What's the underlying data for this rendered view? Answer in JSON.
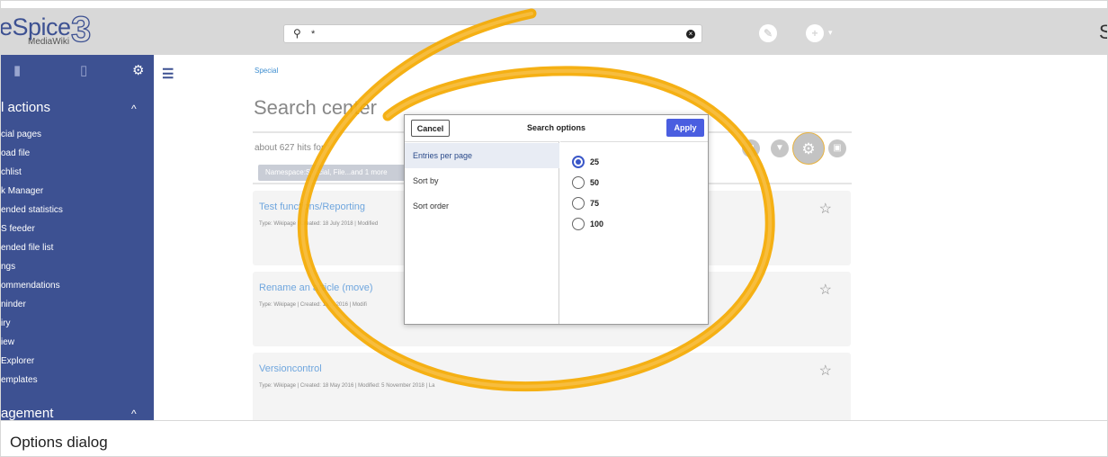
{
  "header": {
    "logo_text": "eSpice",
    "logo_sub": "MediaWiki",
    "logo_number": "3",
    "search_icon": "search-icon",
    "search_value": "*",
    "clear_icon": "clear-icon",
    "edit_icon": "pencil-icon",
    "add_icon": "plus-icon",
    "add_caret": "▾",
    "user_partial": "S"
  },
  "sidebar": {
    "tab_icons": [
      "book-icon",
      "clipboard-icon",
      "gear-icon"
    ],
    "group_title": "l actions",
    "items": [
      "cial pages",
      "oad file",
      "chlist",
      "k Manager",
      "ended statistics",
      "S feeder",
      "ended file list",
      "ngs",
      "ommendations",
      "ninder",
      "iry",
      "iew",
      "Explorer",
      "emplates"
    ],
    "group2_title": "agement",
    "chevron": "^"
  },
  "main": {
    "breadcrumb": "Special",
    "title": "Search center",
    "hits_text": "about 627 hits for *",
    "filter_chip": "Namespace:Special, File...and 1 more",
    "results": [
      {
        "title": "Test functions/Reporting",
        "meta": "Type: Wikipage | Created: 18 July 2018 | Modified"
      },
      {
        "title": "Rename an article (move)",
        "meta": "Type: Wikipage | Created: 13 ... 2016 | Modifi"
      },
      {
        "title": "Versioncontrol",
        "meta": "Type: Wikipage | Created: 18 May 2016 | Modified: 5 November 2018 | La"
      }
    ]
  },
  "dialog": {
    "cancel_label": "Cancel",
    "title": "Search options",
    "apply_label": "Apply",
    "options": [
      "Entries per page",
      "Sort by",
      "Sort order"
    ],
    "selected_option": "Entries per page",
    "values": [
      "25",
      "50",
      "75",
      "100"
    ],
    "selected_value": "25"
  },
  "caption": "Options dialog",
  "colors": {
    "sidebar": "#3d5192",
    "topbar": "#d8d8d8",
    "accent": "#4a5ee0",
    "highlight_stroke": "#f4a900"
  }
}
